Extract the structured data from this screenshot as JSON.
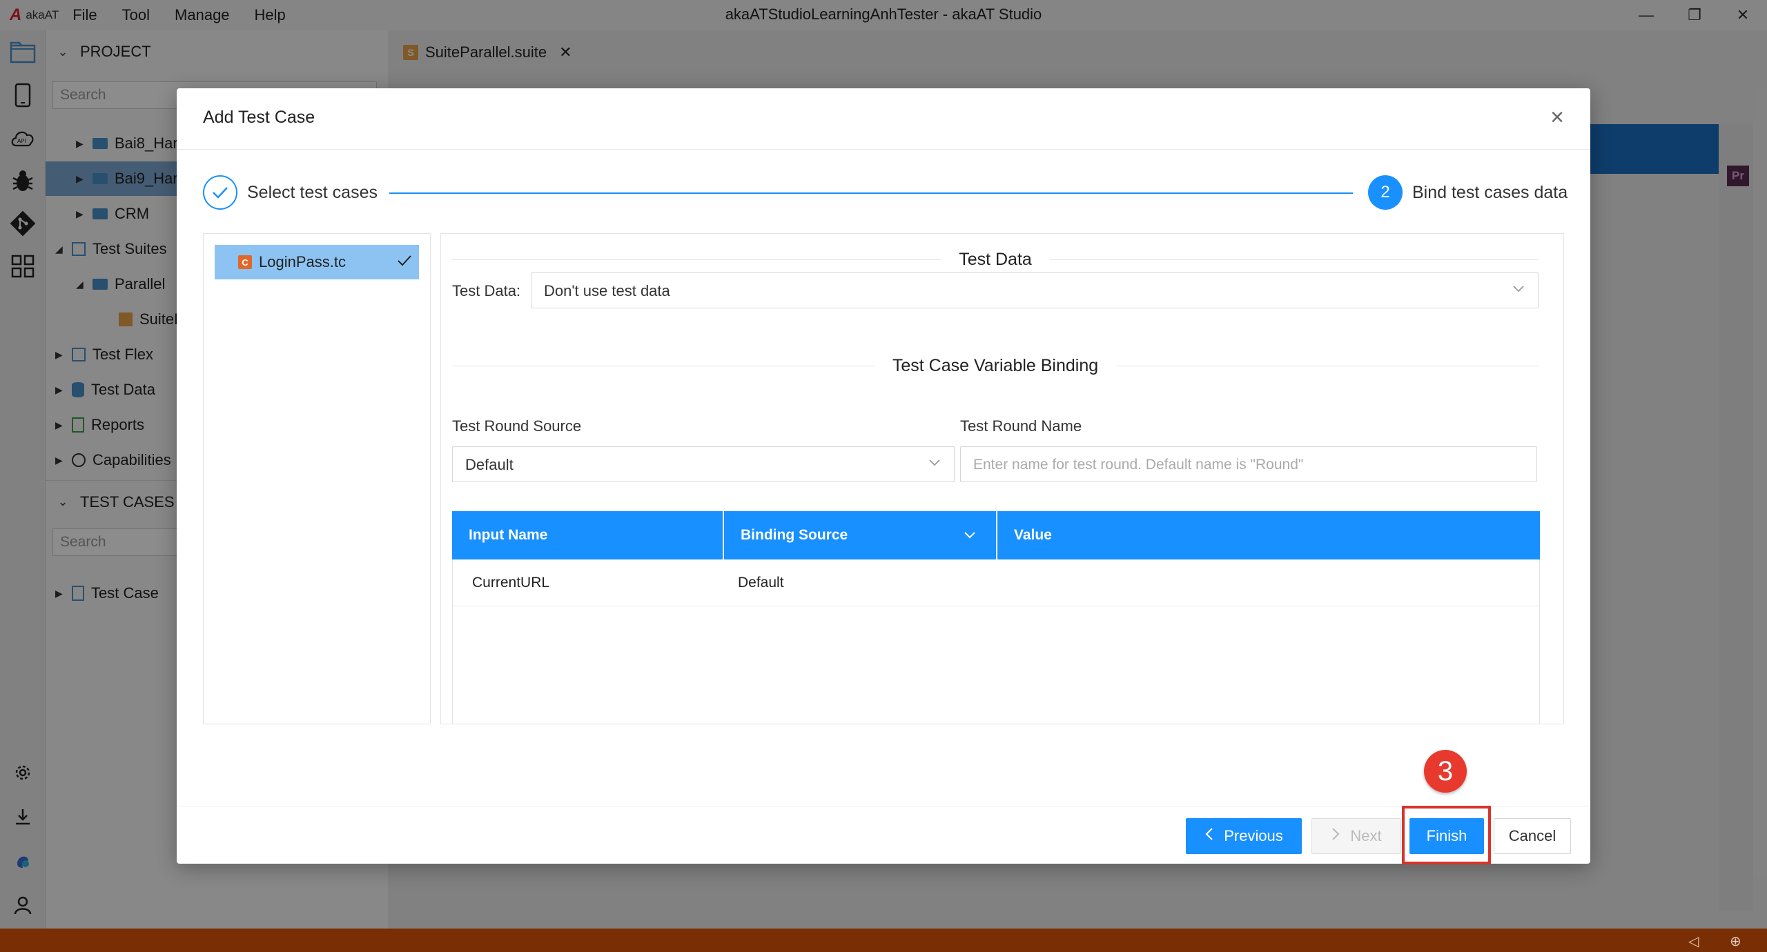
{
  "app": {
    "logo_text": "akaAT",
    "title": "akaATStudioLearningAnhTester - akaAT Studio",
    "menu": [
      "File",
      "Tool",
      "Manage",
      "Help"
    ]
  },
  "project_panel": {
    "header": "PROJECT",
    "search_placeholder": "Search",
    "tree": [
      {
        "label": "Bai8_Har"
      },
      {
        "label": "Bai9_Har"
      },
      {
        "label": "CRM"
      },
      {
        "label": "Test Suites"
      },
      {
        "label": "Parallel"
      },
      {
        "label": "SuiteP"
      },
      {
        "label": "Test Flex"
      },
      {
        "label": "Test Data"
      },
      {
        "label": "Reports"
      },
      {
        "label": "Capabilities"
      }
    ]
  },
  "test_cases_panel": {
    "header": "TEST CASES",
    "search_placeholder": "Search",
    "tree": [
      {
        "label": "Test Case"
      }
    ]
  },
  "editor": {
    "tab_label": "SuiteParallel.suite",
    "right_icon_label": "Pr"
  },
  "dialog": {
    "title": "Add Test Case",
    "steps": [
      {
        "label": "Select test cases",
        "status": "done"
      },
      {
        "number": "2",
        "label": "Bind test cases data",
        "status": "active"
      }
    ],
    "selected_test_case": "LoginPass.tc",
    "test_data_section": {
      "title": "Test Data",
      "field_label": "Test Data:",
      "value": "Don't use test data"
    },
    "binding_section": {
      "title": "Test Case Variable Binding",
      "round_source_label": "Test Round Source",
      "round_source_value": "Default",
      "round_name_label": "Test Round Name",
      "round_name_placeholder": "Enter name for test round. Default name is \"Round\""
    },
    "grid": {
      "columns": [
        "Input Name",
        "Binding Source",
        "Value"
      ],
      "rows": [
        {
          "input_name": "CurrentURL",
          "binding_source": "Default",
          "value": ""
        }
      ]
    },
    "buttons": {
      "previous": "Previous",
      "next": "Next",
      "finish": "Finish",
      "cancel": "Cancel"
    }
  },
  "annotation": {
    "step_number": "3",
    "color": "#d9342b"
  },
  "colors": {
    "primary": "#1890ff",
    "statusbar": "#7a2e04",
    "selection": "#8cc3f2"
  }
}
